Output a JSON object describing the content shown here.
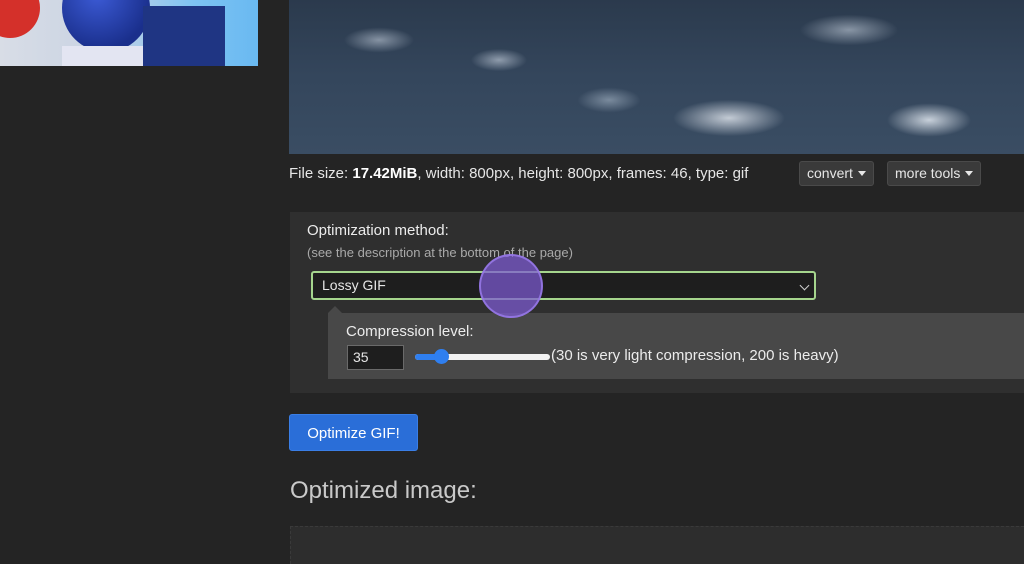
{
  "file_info": {
    "size_label": "File size: ",
    "size_value": "17.42MiB",
    "rest": ", width: 800px, height: 800px, frames: 46, type: gif"
  },
  "tools": {
    "convert_label": "convert",
    "more_tools_label": "more tools"
  },
  "optimization": {
    "title": "Optimization method:",
    "subtitle": "(see the description at the bottom of the page)",
    "selected_method": "Lossy GIF",
    "compression": {
      "label": "Compression level:",
      "value": "35",
      "slider_fraction": 0.19,
      "hint": "(30 is very light compression, 200 is heavy)",
      "accent_color": "#2f7ff0"
    }
  },
  "actions": {
    "optimize_label": "Optimize GIF!"
  },
  "result": {
    "heading": "Optimized image:"
  },
  "colors": {
    "select_focus_border": "#a5d58d",
    "primary_button": "#2a6ed8"
  }
}
